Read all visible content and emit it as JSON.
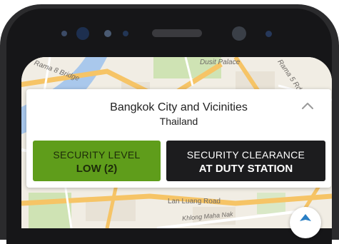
{
  "header": {
    "city": "Bangkok City and Vicinities",
    "country": "Thailand"
  },
  "security_level": {
    "title": "SECURITY LEVEL",
    "value": "LOW (2)",
    "color": "#5f9d1b"
  },
  "security_clearance": {
    "title": "SECURITY CLEARANCE",
    "value": "AT DUTY STATION",
    "color": "#1c1c1e"
  },
  "map": {
    "labels": [
      "Dusit Palace",
      "Rama 8 Bridge",
      "Rama 5 Rd",
      "Lan Luang Road",
      "Khlong Maha Nak"
    ]
  },
  "icons": {
    "collapse": "chevron-up-icon",
    "location": "navigation-arrow-icon"
  }
}
